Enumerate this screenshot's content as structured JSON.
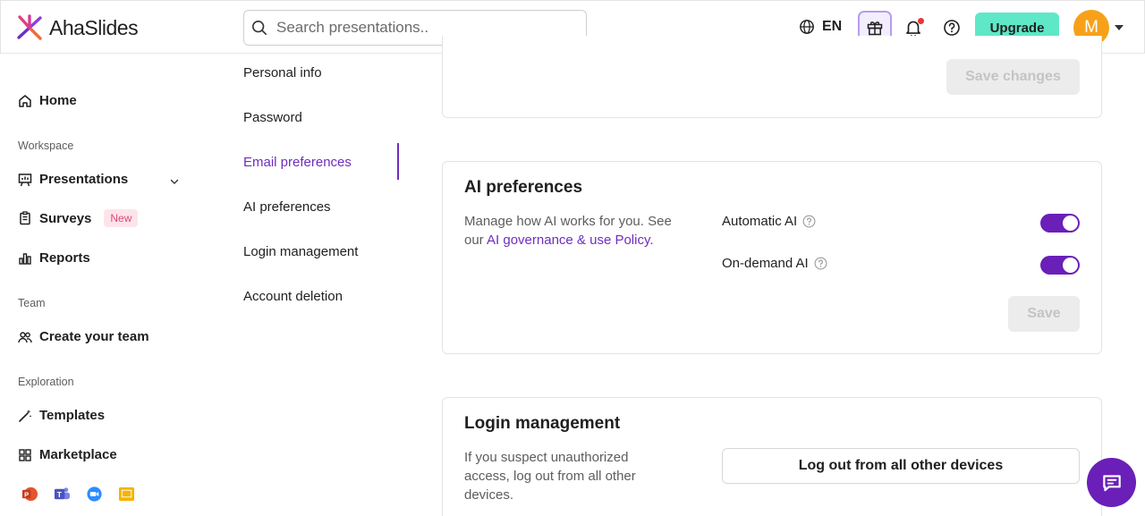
{
  "header": {
    "brand": "AhaSlides",
    "search_placeholder": "Search presentations..",
    "language": "EN",
    "upgrade_label": "Upgrade",
    "avatar_initial": "M",
    "accent_color": "#6f2dbd",
    "upgrade_color": "#5ee8c8",
    "avatar_color": "#f7a11a"
  },
  "sidebar": {
    "home": "Home",
    "workspace_label": "Workspace",
    "presentations": "Presentations",
    "surveys": "Surveys",
    "surveys_badge": "New",
    "reports": "Reports",
    "team_label": "Team",
    "create_team": "Create your team",
    "exploration_label": "Exploration",
    "templates": "Templates",
    "marketplace": "Marketplace",
    "integration_icons": [
      "powerpoint-icon",
      "teams-icon",
      "zoom-icon",
      "google-slides-icon"
    ]
  },
  "settings_nav": {
    "items": [
      "Personal info",
      "Password",
      "Email preferences",
      "AI preferences",
      "Login management",
      "Account deletion"
    ],
    "active": "Email preferences"
  },
  "top_card": {
    "save_changes_label": "Save changes"
  },
  "ai_card": {
    "title": "AI preferences",
    "desc_text": "Manage how AI works for you. See our ",
    "desc_link": "AI governance & use Policy.",
    "automatic_ai_label": "Automatic AI",
    "automatic_ai_on": true,
    "on_demand_ai_label": "On-demand AI",
    "on_demand_ai_on": true,
    "save_label": "Save"
  },
  "login_card": {
    "title": "Login management",
    "desc": "If you suspect unauthorized access, log out from all other devices.",
    "logout_label": "Log out from all other devices"
  }
}
